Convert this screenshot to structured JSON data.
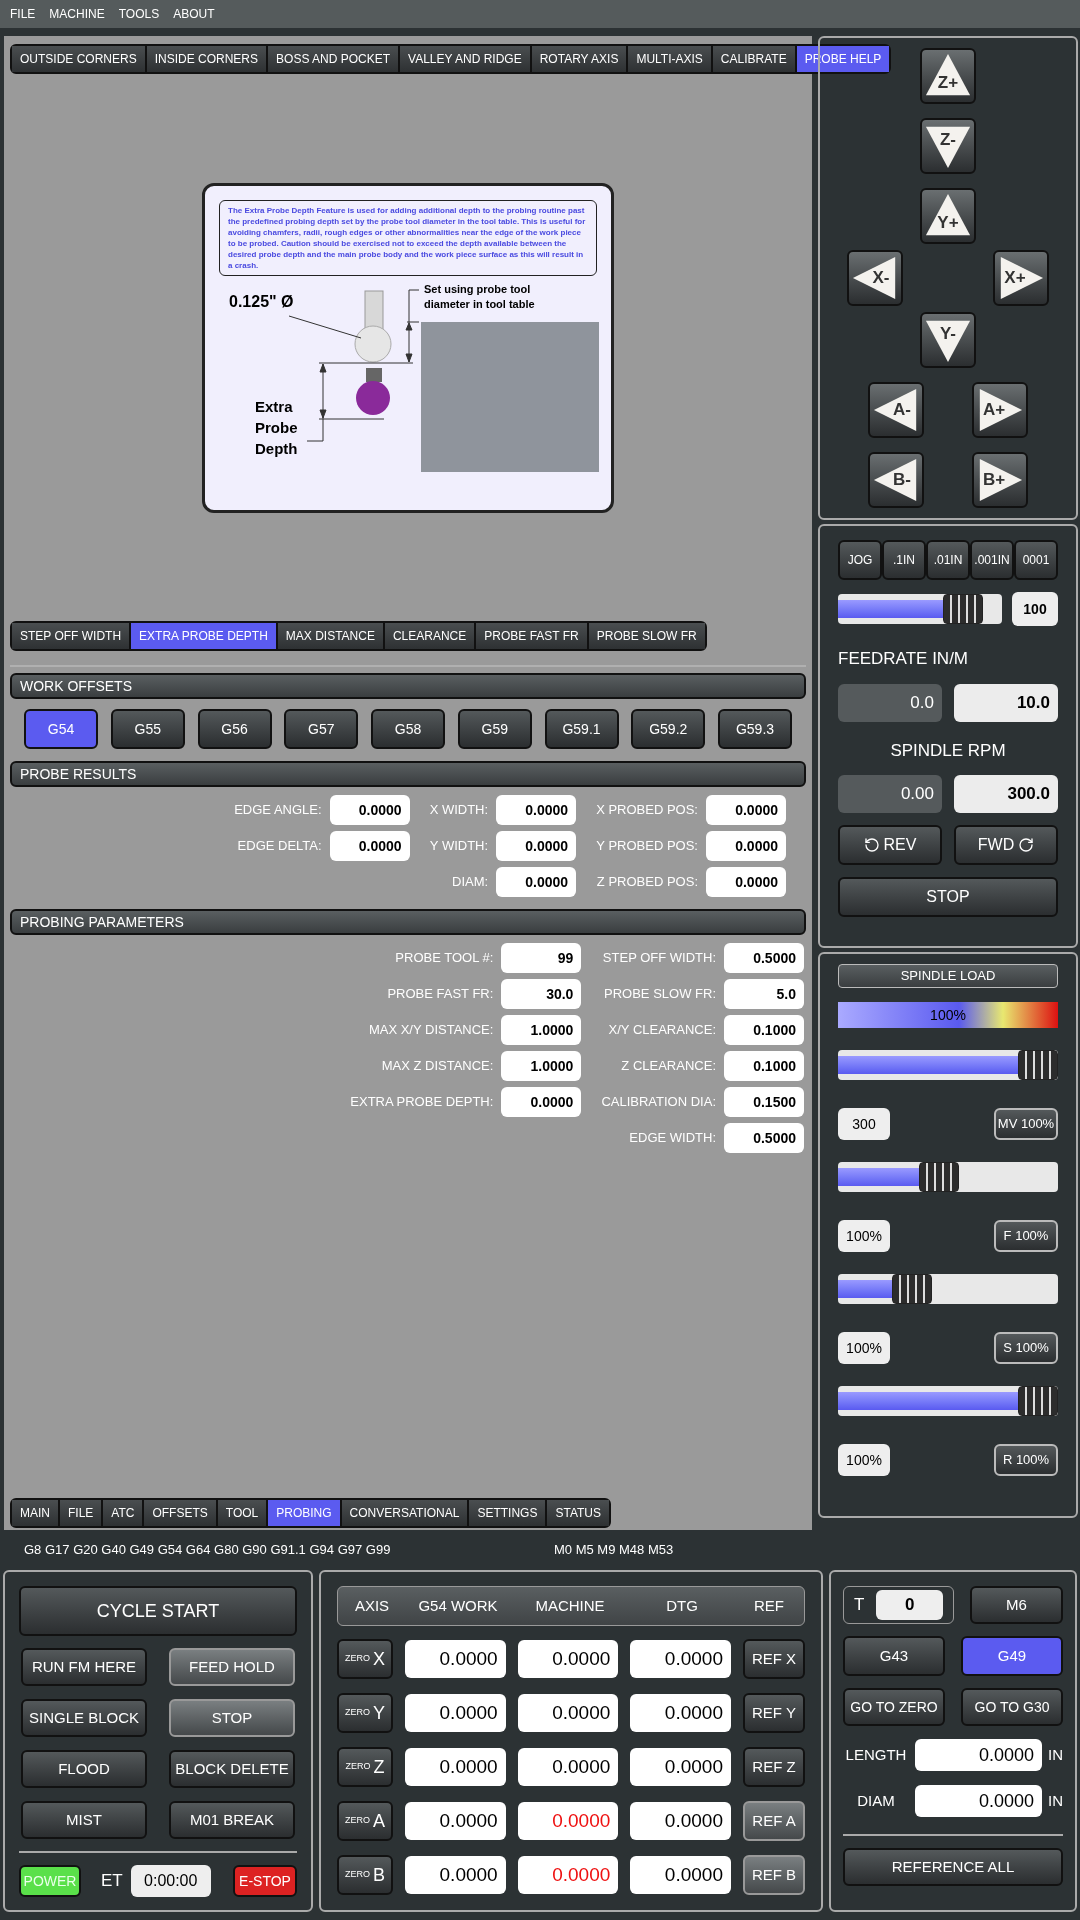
{
  "menu": [
    "FILE",
    "MACHINE",
    "TOOLS",
    "ABOUT"
  ],
  "probe_tabs": [
    {
      "label": "OUTSIDE CORNERS",
      "selected": false
    },
    {
      "label": "INSIDE CORNERS",
      "selected": false
    },
    {
      "label": "BOSS AND POCKET",
      "selected": false
    },
    {
      "label": "VALLEY AND RIDGE",
      "selected": false
    },
    {
      "label": "ROTARY AXIS",
      "selected": false
    },
    {
      "label": "MULTI-AXIS",
      "selected": false
    },
    {
      "label": "CALIBRATE",
      "selected": false
    },
    {
      "label": "PROBE HELP",
      "selected": true
    }
  ],
  "help": {
    "description": "The Extra Probe Depth Feature is used for adding additional depth to the probing routine past the predefined probing depth set by the probe tool diameter in the tool table.  This is useful for avoiding chamfers, radii, rough edges or other abnormalities near the edge of the work piece to be probed.  Caution should be exercised not to exceed the depth available between the desired probe depth and the main probe body and the work piece surface as this will result in a crash.",
    "diameter_label": "0.125\" Ø",
    "note": "Set using probe tool diameter in tool table",
    "depth_label": "Extra Probe Depth"
  },
  "parameter_tabs": [
    {
      "label": "STEP OFF WIDTH",
      "selected": false
    },
    {
      "label": "EXTRA PROBE DEPTH",
      "selected": true
    },
    {
      "label": "MAX DISTANCE",
      "selected": false
    },
    {
      "label": "CLEARANCE",
      "selected": false
    },
    {
      "label": "PROBE FAST FR",
      "selected": false
    },
    {
      "label": "PROBE SLOW FR",
      "selected": false
    }
  ],
  "work_offsets": {
    "title": "WORK OFFSETS",
    "buttons": [
      {
        "label": "G54",
        "selected": true
      },
      {
        "label": "G55",
        "selected": false
      },
      {
        "label": "G56",
        "selected": false
      },
      {
        "label": "G57",
        "selected": false
      },
      {
        "label": "G58",
        "selected": false
      },
      {
        "label": "G59",
        "selected": false
      },
      {
        "label": "G59.1",
        "selected": false
      },
      {
        "label": "G59.2",
        "selected": false
      },
      {
        "label": "G59.3",
        "selected": false
      }
    ]
  },
  "probe_results": {
    "title": "PROBE RESULTS",
    "columns": [
      [
        {
          "label": "EDGE ANGLE:",
          "value": "0.0000"
        },
        {
          "label": "EDGE DELTA:",
          "value": "0.0000"
        }
      ],
      [
        {
          "label": "X WIDTH:",
          "value": "0.0000"
        },
        {
          "label": "Y WIDTH:",
          "value": "0.0000"
        },
        {
          "label": "DIAM:",
          "value": "0.0000"
        }
      ],
      [
        {
          "label": "X PROBED POS:",
          "value": "0.0000"
        },
        {
          "label": "Y PROBED POS:",
          "value": "0.0000"
        },
        {
          "label": "Z PROBED POS:",
          "value": "0.0000"
        }
      ]
    ]
  },
  "probing_parameters": {
    "title": "PROBING PARAMETERS",
    "columns": [
      [
        {
          "label": "PROBE TOOL #:",
          "value": "99"
        },
        {
          "label": "PROBE FAST FR:",
          "value": "30.0"
        },
        {
          "label": "MAX X/Y DISTANCE:",
          "value": "1.0000"
        },
        {
          "label": "MAX Z DISTANCE:",
          "value": "1.0000"
        },
        {
          "label": "EXTRA PROBE DEPTH:",
          "value": "0.0000"
        }
      ],
      [
        {
          "label": "STEP OFF WIDTH:",
          "value": "0.5000"
        },
        {
          "label": "PROBE SLOW FR:",
          "value": "5.0"
        },
        {
          "label": "X/Y CLEARANCE:",
          "value": "0.1000"
        },
        {
          "label": "Z CLEARANCE:",
          "value": "0.1000"
        },
        {
          "label": "CALIBRATION DIA:",
          "value": "0.1500"
        },
        {
          "label": "EDGE WIDTH:",
          "value": "0.5000"
        }
      ]
    ]
  },
  "bottom_tabs": [
    {
      "label": "MAIN",
      "selected": false
    },
    {
      "label": "FILE",
      "selected": false
    },
    {
      "label": "ATC",
      "selected": false
    },
    {
      "label": "OFFSETS",
      "selected": false
    },
    {
      "label": "TOOL",
      "selected": false
    },
    {
      "label": "PROBING",
      "selected": true
    },
    {
      "label": "CONVERSATIONAL",
      "selected": false
    },
    {
      "label": "SETTINGS",
      "selected": false
    },
    {
      "label": "STATUS",
      "selected": false
    }
  ],
  "modal_codes": {
    "g_codes": "G8 G17 G20 G40 G49 G54 G64 G80 G90 G91.1 G94 G97 G99",
    "m_codes": "M0 M5 M9 M48 M53"
  },
  "cycle_panel": {
    "cycle_start": "CYCLE START",
    "buttons": [
      {
        "label": "RUN FM HERE",
        "lit": false
      },
      {
        "label": "FEED HOLD",
        "lit": true
      },
      {
        "label": "SINGLE BLOCK",
        "lit": false
      },
      {
        "label": "STOP",
        "lit": true
      },
      {
        "label": "FLOOD",
        "lit": false
      },
      {
        "label": "BLOCK DELETE",
        "lit": false
      },
      {
        "label": "MIST",
        "lit": false
      },
      {
        "label": "M01 BREAK",
        "lit": false
      }
    ],
    "power": {
      "label": "POWER",
      "on": true
    },
    "et_label": "ET",
    "et_value": "0:00:00",
    "estop": "E-STOP"
  },
  "dro": {
    "columns": [
      "AXIS",
      "G54 WORK",
      "MACHINE",
      "DTG",
      "REF"
    ],
    "rows": [
      {
        "zero": "ZERO",
        "axis": "X",
        "work": "0.0000",
        "machine": "0.0000",
        "machine_alert": false,
        "dtg": "0.0000",
        "ref": "REF X",
        "ref_lit": false
      },
      {
        "zero": "ZERO",
        "axis": "Y",
        "work": "0.0000",
        "machine": "0.0000",
        "machine_alert": false,
        "dtg": "0.0000",
        "ref": "REF Y",
        "ref_lit": false
      },
      {
        "zero": "ZERO",
        "axis": "Z",
        "work": "0.0000",
        "machine": "0.0000",
        "machine_alert": false,
        "dtg": "0.0000",
        "ref": "REF Z",
        "ref_lit": false
      },
      {
        "zero": "ZERO",
        "axis": "A",
        "work": "0.0000",
        "machine": "0.0000",
        "machine_alert": true,
        "dtg": "0.0000",
        "ref": "REF A",
        "ref_lit": true
      },
      {
        "zero": "ZERO",
        "axis": "B",
        "work": "0.0000",
        "machine": "0.0000",
        "machine_alert": true,
        "dtg": "0.0000",
        "ref": "REF B",
        "ref_lit": true
      }
    ]
  },
  "tool_panel": {
    "t_label": "T",
    "t_value": "0",
    "m6": "M6",
    "offsets": [
      {
        "label": "G43",
        "selected": false
      },
      {
        "label": "G49",
        "selected": true
      }
    ],
    "go_zero": "GO TO ZERO",
    "go_g30": "GO TO G30",
    "length": {
      "label": "LENGTH",
      "value": "0.0000",
      "unit": "IN"
    },
    "diam": {
      "label": "DIAM",
      "value": "0.0000",
      "unit": "IN"
    },
    "reference_all": "REFERENCE ALL"
  },
  "jog": {
    "rows": [
      [
        {
          "label": "Z+",
          "kind": "up"
        }
      ],
      [
        {
          "label": "Z-",
          "kind": "down"
        }
      ],
      [
        {
          "label": "Y+",
          "kind": "up"
        }
      ],
      [
        {
          "label": "X-",
          "kind": "left"
        },
        {
          "label": "X+",
          "kind": "right"
        }
      ],
      [
        {
          "label": "Y-",
          "kind": "down"
        }
      ],
      [
        {
          "label": "A-",
          "kind": "left"
        },
        {
          "label": "A+",
          "kind": "right"
        }
      ],
      [
        {
          "label": "B-",
          "kind": "left"
        },
        {
          "label": "B+",
          "kind": "right"
        }
      ]
    ]
  },
  "increments": [
    "JOG",
    ".1IN",
    ".01IN",
    ".001IN",
    "0001"
  ],
  "jog_rate": {
    "level": 0.85,
    "value": "100"
  },
  "feedrate": {
    "title": "FEEDRATE IN/M",
    "actual": "0.0",
    "commanded": "10.0"
  },
  "spindle": {
    "title": "SPINDLE RPM",
    "actual": "0.00",
    "commanded": "300.0",
    "rev": "REV",
    "fwd": "FWD",
    "stop": "STOP"
  },
  "spindle_load": {
    "title": "SPINDLE LOAD",
    "level": 1,
    "reading": "100%"
  },
  "overrides": [
    {
      "level": 1,
      "value": "300",
      "button": "MV 100%"
    },
    {
      "level": 0.45,
      "value": "100%",
      "button": "F 100%"
    },
    {
      "level": 0.3,
      "value": "100%",
      "button": "S 100%"
    },
    {
      "level": 1,
      "value": "100%",
      "button": "R 100%"
    }
  ]
}
